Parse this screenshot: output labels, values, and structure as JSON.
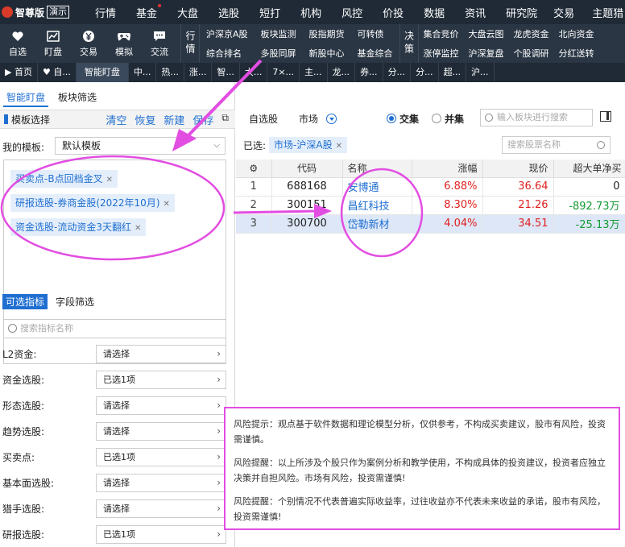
{
  "menubar": {
    "brand": "智尊版",
    "demo_badge": "演示",
    "items": [
      "行情",
      "基金",
      "大盘",
      "选股",
      "短打",
      "机构",
      "风控",
      "价投",
      "数据",
      "资讯",
      "研究院",
      "交易",
      "主题猎"
    ]
  },
  "toolbar": {
    "buttons": [
      {
        "label": "自选",
        "icon": "heart-icon"
      },
      {
        "label": "盯盘",
        "icon": "chart-icon"
      },
      {
        "label": "交易",
        "icon": "yen-icon"
      },
      {
        "label": "模拟",
        "icon": "gamepad-icon"
      },
      {
        "label": "交流",
        "icon": "chat-icon"
      }
    ],
    "group1_label": "行情",
    "group1_items": [
      "沪深京A股",
      "板块监测",
      "股指期货",
      "可转债",
      "综合排名",
      "多股同屏",
      "新股中心",
      "基金综合"
    ],
    "group2_label": "决策",
    "group2_items": [
      "集合竞价",
      "大盘云图",
      "龙虎资金",
      "北向资金",
      "涨停监控",
      "沪深复盘",
      "个股调研",
      "分红送转"
    ]
  },
  "tabbar": {
    "tabs": [
      "首页",
      "自...",
      "智能盯盘",
      "中...",
      "热...",
      "涨...",
      "智...",
      "大...",
      "7×...",
      "主...",
      "龙...",
      "券...",
      "分...",
      "分...",
      "超...",
      "沪..."
    ]
  },
  "left": {
    "sub_tabs": [
      "智能盯盘",
      "板块筛选"
    ],
    "template_header": "模板选择",
    "actions": [
      "清空",
      "恢复",
      "新建",
      "保存"
    ],
    "my_template_label": "我的模板:",
    "my_template_value": "默认模板",
    "chips": [
      "买卖点-B点回档金叉",
      "研报选股-券商金股(2022年10月)",
      "资金选股-流动资金3天翻红"
    ],
    "indicator_tabs": [
      "可选指标",
      "字段筛选"
    ],
    "indicator_search_placeholder": "搜索指标名称",
    "filters": [
      {
        "label": "L2资金:",
        "value": "请选择"
      },
      {
        "label": "资金选股:",
        "value": "已选1项"
      },
      {
        "label": "形态选股:",
        "value": "请选择"
      },
      {
        "label": "趋势选股:",
        "value": "请选择"
      },
      {
        "label": "买卖点:",
        "value": "已选1项"
      },
      {
        "label": "基本面选股:",
        "value": "请选择"
      },
      {
        "label": "猎手选股:",
        "value": "请选择"
      },
      {
        "label": "研报选股:",
        "value": "已选1项"
      }
    ]
  },
  "right": {
    "watchlist_label": "自选股",
    "market_label": "市场",
    "radio_intersect": "交集",
    "radio_union": "并集",
    "block_search_placeholder": "输入板块进行搜索",
    "selected_label": "已选:",
    "selected_chip": "市场-沪深A股",
    "stock_search_placeholder": "搜索股票名称",
    "columns": [
      "代码",
      "名称",
      "涨幅",
      "现价",
      "超大单净买"
    ],
    "rows": [
      {
        "idx": "1",
        "code": "688168",
        "name": "安博通",
        "change": "6.88%",
        "price": "36.64",
        "net": "0"
      },
      {
        "idx": "2",
        "code": "300151",
        "name": "昌红科技",
        "change": "8.30%",
        "price": "21.26",
        "net": "-892.73万"
      },
      {
        "idx": "3",
        "code": "300700",
        "name": "岱勒新材",
        "change": "4.04%",
        "price": "34.51",
        "net": "-25.13万"
      }
    ]
  },
  "risk": {
    "p1": "风险提示：观点基于软件数据和理论模型分析，仅供参考，不构成买卖建议，股市有风险，投资需谨慎。",
    "p2": "风险提醒：以上所涉及个股只作为案例分析和教学使用，不构成具体的投资建议，投资者应独立决策并自担风险。市场有风险，投资需谨慎!",
    "p3": "风险提醒：个别情况不代表普遍实际收益率，过往收益亦不代表未来收益的承诺，股市有风险，投资需谨慎!"
  },
  "colors": {
    "accent": "#1f6fd1",
    "up": "#e02020",
    "down": "#149a34",
    "annotation": "#e24de2"
  }
}
